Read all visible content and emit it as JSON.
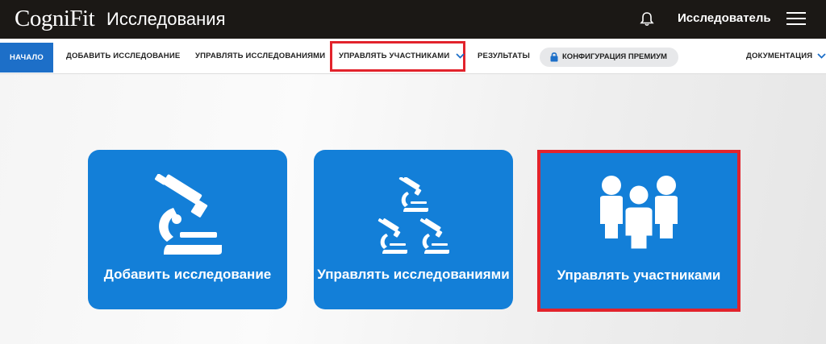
{
  "header": {
    "logo": "CogniFit",
    "logo_sub": "Исследования",
    "user_label": "Исследователь",
    "bell_icon": "bell-icon",
    "menu_icon": "hamburger-menu-icon"
  },
  "nav": {
    "items": [
      {
        "label": "НАЧАЛО"
      },
      {
        "label": "ДОБАВИТЬ ИССЛЕДОВАНИЕ"
      },
      {
        "label": "УПРАВЛЯТЬ ИССЛЕДОВАНИЯМИ"
      },
      {
        "label": "УПРАВЛЯТЬ УЧАСТНИКАМИ"
      },
      {
        "label": "РЕЗУЛЬТАТЫ"
      },
      {
        "label": "КОНФИГУРАЦИЯ ПРЕМИУМ"
      },
      {
        "label": "ДОКУМЕНТАЦИЯ"
      }
    ],
    "active_index": 0,
    "accent_color": "#1d6fc8",
    "highlight_color": "#e2232c"
  },
  "cards": [
    {
      "label": "Добавить исследование",
      "icon": "microscope-icon"
    },
    {
      "label": "Управлять исследованиями",
      "icon": "microscopes-icon"
    },
    {
      "label": "Управлять участниками",
      "icon": "users-group-icon"
    }
  ],
  "card_color": "#137fd8"
}
